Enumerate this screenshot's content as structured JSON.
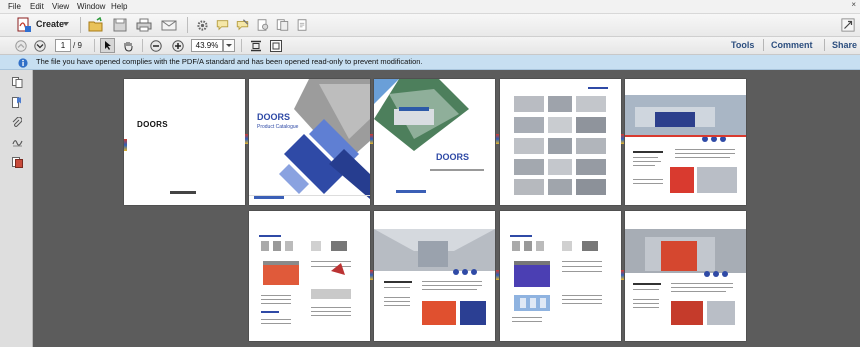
{
  "menu": [
    "File",
    "Edit",
    "View",
    "Window",
    "Help"
  ],
  "toolbar": {
    "create_label": "Create",
    "page_current": "1",
    "page_total": "/ 9",
    "zoom": "43.9%",
    "tools_label": "Tools",
    "comment_label": "Comment",
    "share_label": "Share"
  },
  "infobar": {
    "text": "The file you have opened complies with the PDF/A standard and has been opened read-only to prevent modification."
  },
  "pages": {
    "p1_title": "DOORS",
    "p2_title": "DOORS",
    "p2_subtitle": "Product Catalogue",
    "p3_title": "DOORS"
  },
  "colors": {
    "accent_blue": "#2f4aa6",
    "info_bar": "#c7dff1",
    "doc_bg": "#5c5c5c"
  }
}
